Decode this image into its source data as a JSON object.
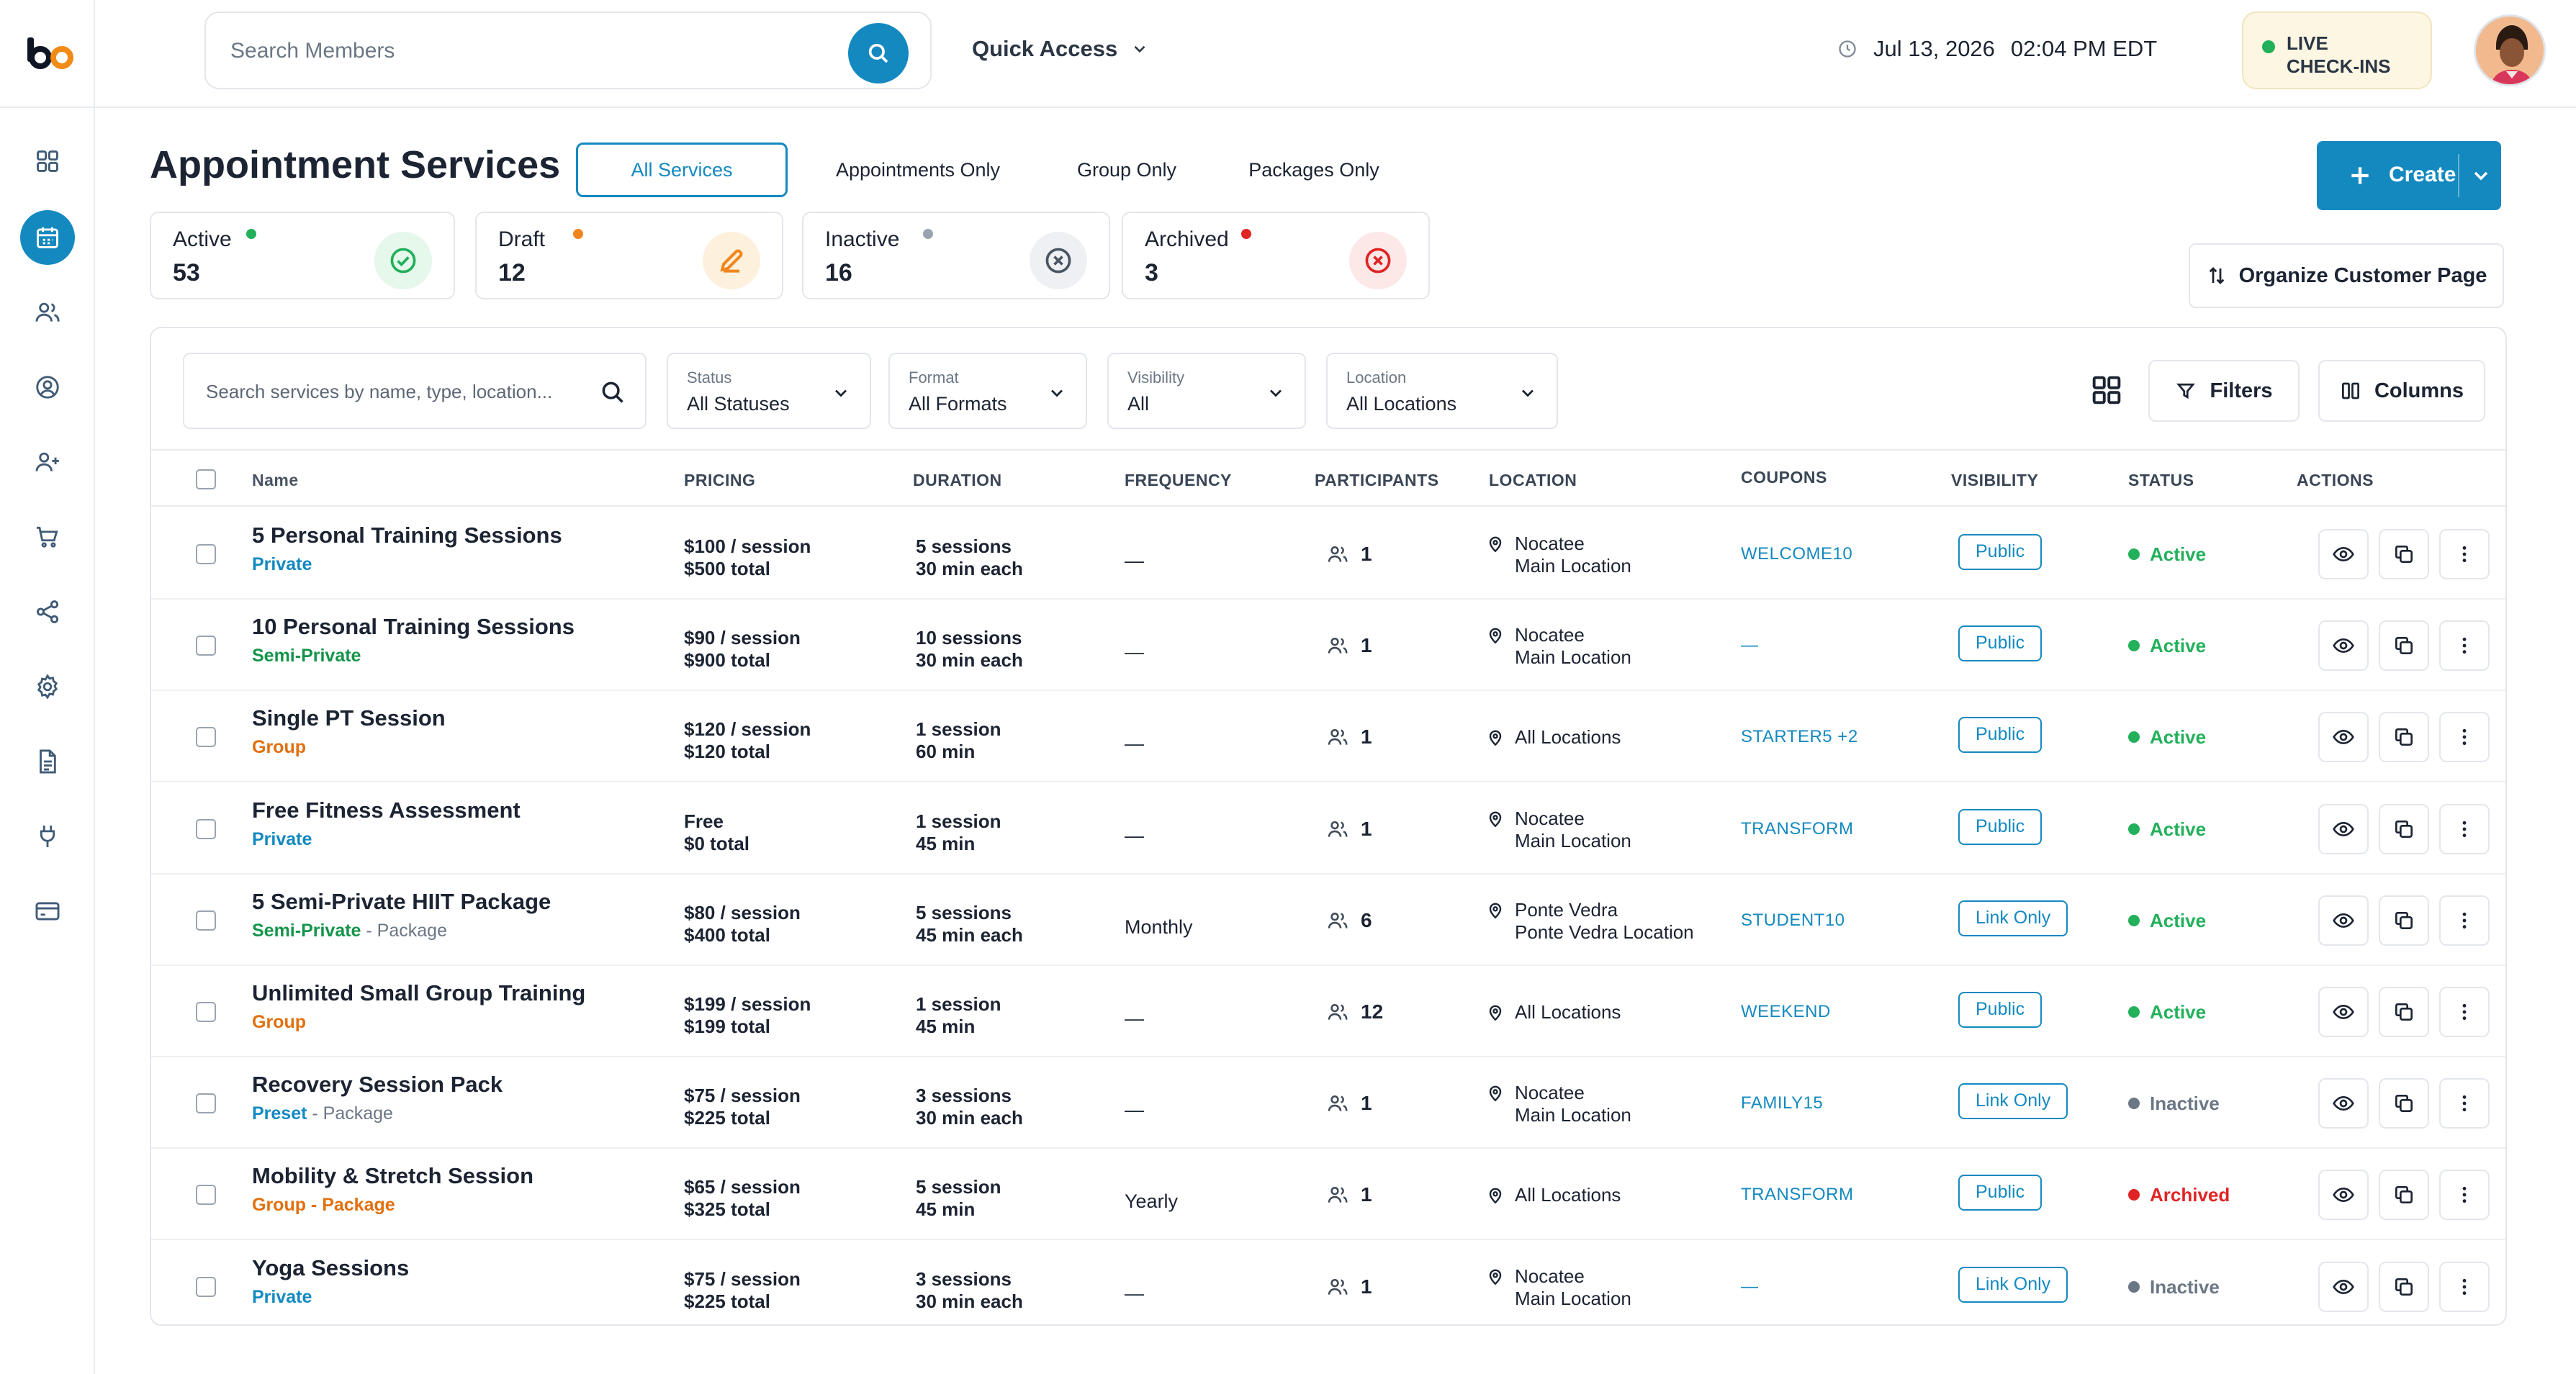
{
  "header": {
    "search_placeholder": "Search Members",
    "quick_access": "Quick Access",
    "date": "Jul 13, 2026",
    "time": "02:04 PM EDT",
    "live_line1": "LIVE",
    "live_line2": "CHECK-INS",
    "live_color": "#22b05a"
  },
  "sidebar": {
    "items": [
      {
        "icon": "dashboard-grid-icon"
      },
      {
        "icon": "calendar-icon",
        "active": true
      },
      {
        "icon": "users-icon"
      },
      {
        "icon": "user-circle-icon"
      },
      {
        "icon": "user-plus-icon"
      },
      {
        "icon": "cart-icon"
      },
      {
        "icon": "share-icon"
      },
      {
        "icon": "settings-icon"
      },
      {
        "icon": "document-icon"
      },
      {
        "icon": "plug-icon"
      },
      {
        "icon": "credit-card-icon"
      }
    ]
  },
  "page": {
    "title": "Appointment Services",
    "tabs": [
      "All Services",
      "Appointments  Only",
      "Group  Only",
      "Packages Only"
    ],
    "create_label": "Create",
    "organize_label": "Organize Customer Page",
    "accent": "#1489c0"
  },
  "stats": [
    {
      "label": "Active",
      "value": "53",
      "color": "#22b05a"
    },
    {
      "label": "Draft",
      "value": "12",
      "color": "#f0861c"
    },
    {
      "label": "Inactive",
      "value": "16",
      "color": "#9aa4b0"
    },
    {
      "label": "Archived",
      "value": "3",
      "color": "#e02424"
    }
  ],
  "filters": {
    "search_placeholder": "Search services by name, type, location...",
    "status": {
      "caption": "Status",
      "value": "All Statuses"
    },
    "format": {
      "caption": "Format",
      "value": "All Formats"
    },
    "visibility": {
      "caption": "Visibility",
      "value": "All"
    },
    "location": {
      "caption": "Location",
      "value": "All Locations"
    },
    "filters_label": "Filters",
    "columns_label": "Columns"
  },
  "table": {
    "headers": {
      "name": "Name",
      "pricing": "PRICING",
      "duration": "DURATION",
      "frequency": "FREQUENCY",
      "participants": "PARTICIPANTS",
      "location": "LOCATION",
      "coupons": "COUPONS",
      "visibility": "VISIBILITY",
      "status": "STATUS",
      "actions": "ACTIONS"
    },
    "rows": [
      {
        "name": "5 Personal Training Sessions",
        "type": "Private",
        "type_color": "#1489c0",
        "extra": "",
        "price1": "$100 / session",
        "price2": "$500 total",
        "dur1": "5 sessions",
        "dur2": "30 min each",
        "frequency": "—",
        "participants": "1",
        "loc1": "Nocatee",
        "loc2": "Main Location",
        "coupon": "WELCOME10",
        "visibility": "Public",
        "status": "Active",
        "status_color": "#22b05a"
      },
      {
        "name": "10 Personal Training Sessions",
        "type": "Semi-Private",
        "type_color": "#15944a",
        "extra": "",
        "price1": "$90 / session",
        "price2": "$900 total",
        "dur1": "10 sessions",
        "dur2": "30 min each",
        "frequency": "—",
        "participants": "1",
        "loc1": "Nocatee",
        "loc2": "Main Location",
        "coupon": "—",
        "visibility": "Public",
        "status": "Active",
        "status_color": "#22b05a"
      },
      {
        "name": "Single PT Session",
        "type": "Group",
        "type_color": "#e0700f",
        "extra": "",
        "price1": "$120 / session",
        "price2": "$120 total",
        "dur1": "1 session",
        "dur2": "60 min",
        "frequency": "—",
        "participants": "1",
        "loc1": "All Locations",
        "loc2": "",
        "coupon": "STARTER5 +2",
        "visibility": "Public",
        "status": "Active",
        "status_color": "#22b05a"
      },
      {
        "name": "Free Fitness Assessment",
        "type": "Private",
        "type_color": "#1489c0",
        "extra": "",
        "price1": "Free",
        "price2": "$0 total",
        "dur1": "1 session",
        "dur2": "45 min",
        "frequency": "—",
        "participants": "1",
        "loc1": "Nocatee",
        "loc2": "Main Location",
        "coupon": "TRANSFORM",
        "visibility": "Public",
        "status": "Active",
        "status_color": "#22b05a"
      },
      {
        "name": "5 Semi-Private HIIT Package",
        "type": "Semi-Private",
        "type_color": "#15944a",
        "extra": " - Package",
        "price1": "$80 / session",
        "price2": "$400 total",
        "dur1": "5 sessions",
        "dur2": "45 min each",
        "frequency": "Monthly",
        "participants": "6",
        "loc1": "Ponte Vedra",
        "loc2": "Ponte Vedra Location",
        "coupon": "STUDENT10",
        "visibility": "Link Only",
        "status": "Active",
        "status_color": "#22b05a"
      },
      {
        "name": "Unlimited Small Group Training",
        "type": "Group",
        "type_color": "#e0700f",
        "extra": "",
        "price1": "$199 / session",
        "price2": "$199 total",
        "dur1": "1 session",
        "dur2": "45 min",
        "frequency": "—",
        "participants": "12",
        "loc1": "All Locations",
        "loc2": "",
        "coupon": "WEEKEND",
        "visibility": "Public",
        "status": "Active",
        "status_color": "#22b05a"
      },
      {
        "name": "Recovery Session Pack",
        "type": "Preset",
        "type_color": "#1489c0",
        "extra": "  - Package",
        "price1": "$75 / session",
        "price2": "$225 total",
        "dur1": "3 sessions",
        "dur2": "30 min each",
        "frequency": "—",
        "participants": "1",
        "loc1": "Nocatee",
        "loc2": "Main Location",
        "coupon": "FAMILY15",
        "visibility": "Link Only",
        "status": "Inactive",
        "status_color": "#6b7785"
      },
      {
        "name": "Mobility & Stretch Session",
        "type": "Group - Package",
        "type_color": "#e0700f",
        "extra": "",
        "price1": "$65 / session",
        "price2": "$325 total",
        "dur1": "5 session",
        "dur2": "45 min",
        "frequency": "Yearly",
        "participants": "1",
        "loc1": "All Locations",
        "loc2": "",
        "coupon": "TRANSFORM",
        "visibility": "Public",
        "status": "Archived",
        "status_color": "#e02424"
      },
      {
        "name": "Yoga Sessions",
        "type": "Private",
        "type_color": "#1489c0",
        "extra": "",
        "price1": "$75 / session",
        "price2": "$225 total",
        "dur1": "3 sessions",
        "dur2": "30 min each",
        "frequency": "—",
        "participants": "1",
        "loc1": "Nocatee",
        "loc2": "Main Location",
        "coupon": "—",
        "visibility": "Link Only",
        "status": "Inactive",
        "status_color": "#6b7785"
      }
    ]
  }
}
